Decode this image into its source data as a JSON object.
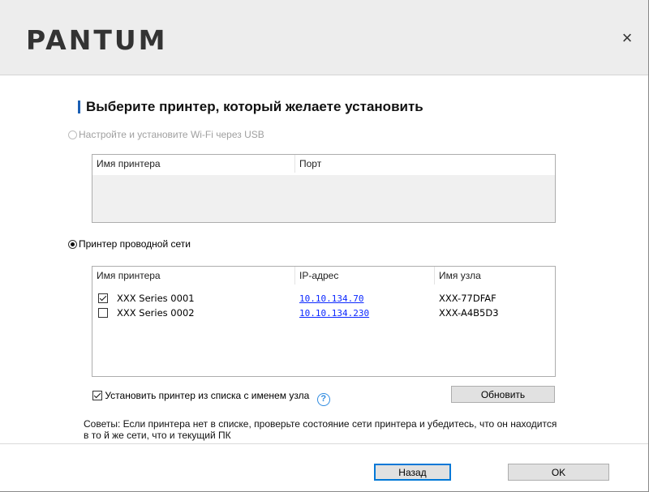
{
  "brand": {
    "logo": "PANTUM"
  },
  "close_icon": "×",
  "title": "Выберите принтер, который желаете установить",
  "usb_option": {
    "label": "Настройте и установите Wi-Fi через USB",
    "selected": false,
    "enabled": false
  },
  "usb_table": {
    "columns": [
      "Имя принтера",
      "Порт"
    ],
    "rows": []
  },
  "wired_option": {
    "label": "Принтер проводной сети",
    "selected": true
  },
  "network_table": {
    "columns": [
      "Имя принтера",
      "IP-адрес",
      "Имя узла"
    ],
    "rows": [
      {
        "checked": true,
        "name": "XXX Series 0001",
        "ip": "10.10.134.70",
        "host": "XXX-77DFAF"
      },
      {
        "checked": false,
        "name": "XXX Series 0002",
        "ip": "10.10.134.230",
        "host": "XXX-A4B5D3"
      }
    ]
  },
  "install_by_hostname": {
    "label": "Установить принтер из списка с именем узла",
    "checked": true,
    "help_glyph": "?"
  },
  "refresh_button": "Обновить",
  "tips": "Советы: Если принтера нет в списке, проверьте состояние сети принтера и убедитесь, что он находится в то й же сети, что и текущий ПК",
  "footer": {
    "back_button": "Назад",
    "ok_button": "OK"
  },
  "colors": {
    "accent": "#1a5fb4",
    "link": "#0b28ff",
    "header_bg": "#ededed",
    "focus_border": "#0078d7"
  }
}
